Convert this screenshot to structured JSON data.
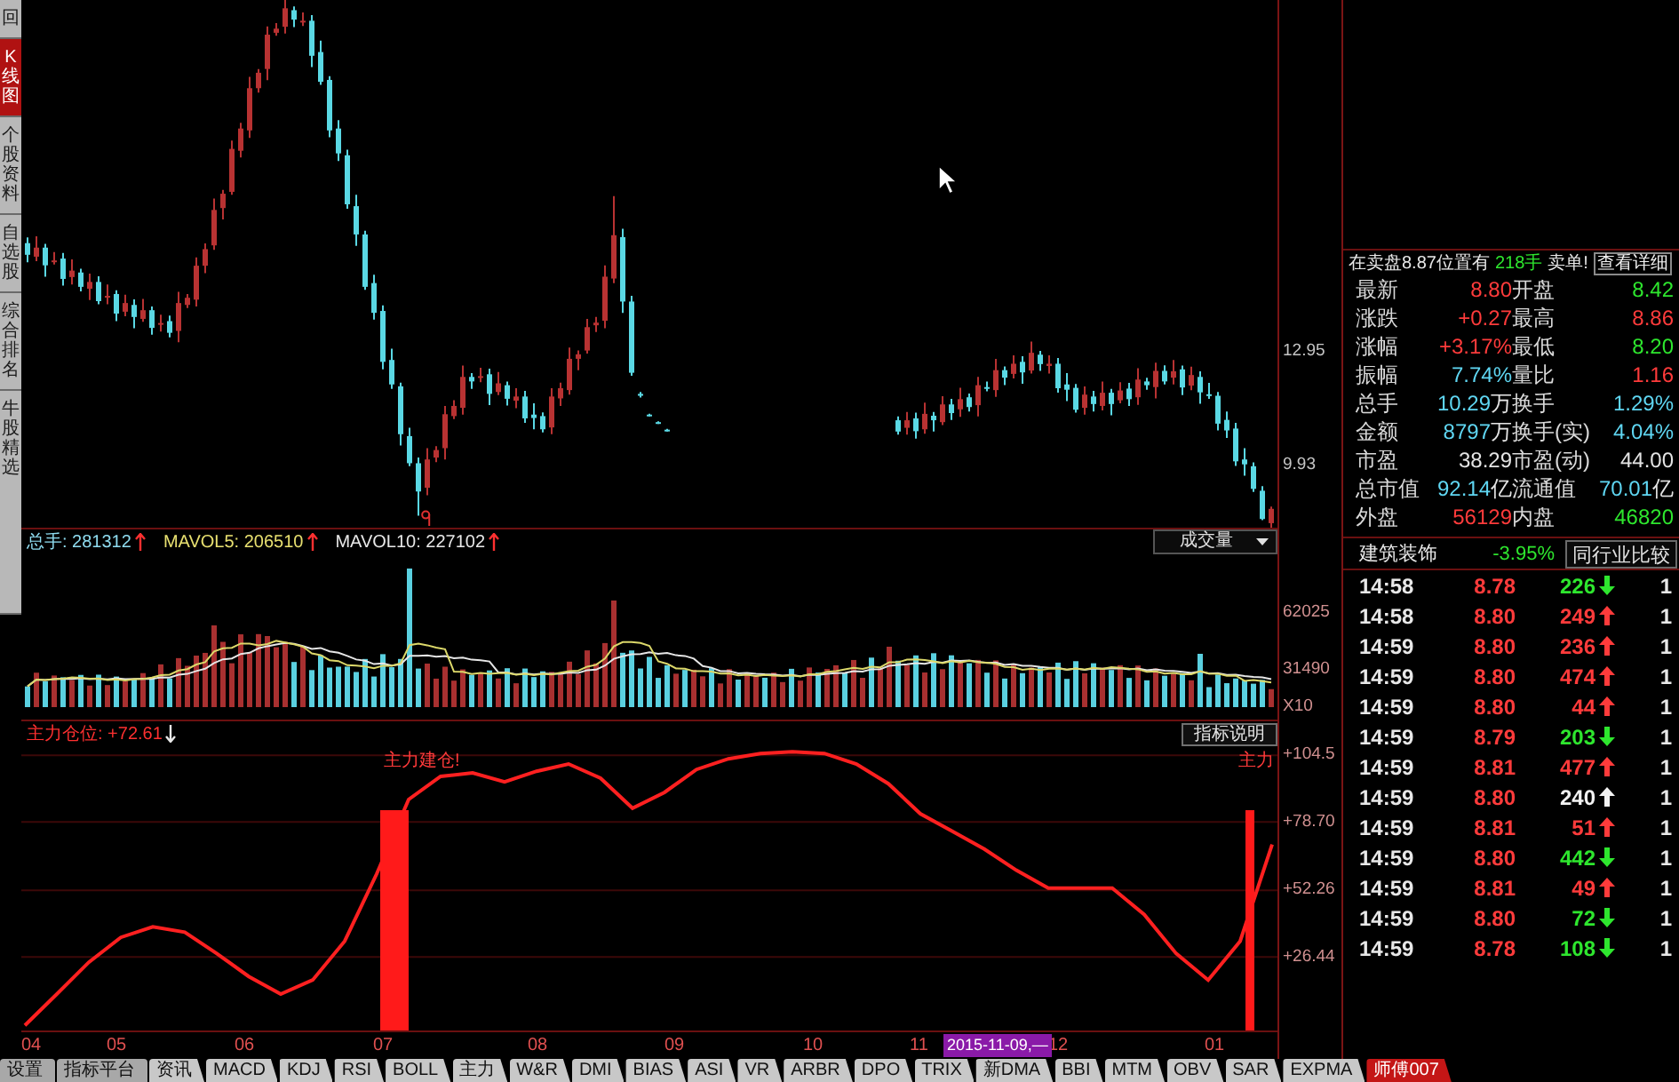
{
  "sidebar": {
    "tabs": [
      {
        "label": "回",
        "selected": false
      },
      {
        "label": "K线图",
        "selected": true
      },
      {
        "label": "个股资料",
        "selected": false
      },
      {
        "label": "自选股",
        "selected": false
      },
      {
        "label": "综合排名",
        "selected": false
      },
      {
        "label": "牛股精选",
        "selected": false
      }
    ]
  },
  "kline": {
    "chart_data": {
      "type": "candlestick",
      "ylim": [
        8.3,
        22.3
      ],
      "yticks": [
        {
          "value": 12.95,
          "label": "12.95"
        },
        {
          "value": 9.93,
          "label": "9.93"
        }
      ],
      "categories": [
        null,
        null,
        null,
        null,
        null,
        null,
        null,
        null,
        null,
        null,
        null,
        null,
        null,
        null,
        null,
        null,
        null,
        null,
        null,
        null,
        null,
        null,
        null,
        null,
        null,
        null,
        null,
        null,
        null,
        null,
        null,
        null,
        null,
        null,
        null,
        null,
        null,
        null,
        null,
        null,
        null,
        null,
        null,
        null,
        null,
        null,
        null,
        null,
        null,
        null,
        null,
        null,
        null,
        null,
        null,
        null,
        null,
        null,
        null,
        null,
        null,
        null,
        null,
        null,
        null,
        null,
        null,
        null,
        null,
        null,
        null,
        null,
        null,
        null,
        null,
        null,
        null,
        null,
        null,
        null,
        null,
        null,
        null,
        null,
        null,
        null,
        null,
        null,
        null,
        null,
        null,
        null,
        null,
        null,
        null,
        null,
        null,
        null,
        null,
        null,
        null,
        null,
        null,
        null,
        null,
        null,
        null,
        null,
        null,
        null,
        null,
        null,
        null,
        null,
        null,
        null,
        null,
        null,
        null,
        null,
        null,
        null,
        null,
        null,
        null,
        null,
        null,
        null,
        null,
        null,
        null,
        null,
        null,
        null,
        null,
        null,
        null,
        null,
        null,
        null,
        null
      ],
      "ohlc": [
        [
          15.85,
          16.0,
          15.34,
          15.54
        ],
        [
          15.49,
          16.03,
          15.37,
          15.73
        ],
        [
          15.73,
          15.83,
          14.96,
          15.26
        ],
        [
          15.36,
          15.61,
          15.28,
          15.39
        ],
        [
          15.44,
          15.59,
          14.72,
          14.9
        ],
        [
          14.95,
          15.42,
          14.75,
          15.12
        ],
        [
          15.07,
          15.17,
          14.57,
          14.69
        ],
        [
          14.64,
          15.04,
          14.34,
          14.82
        ],
        [
          14.82,
          14.97,
          14.23,
          14.31
        ],
        [
          14.41,
          14.75,
          14.23,
          14.45
        ],
        [
          14.5,
          14.6,
          13.78,
          13.98
        ],
        [
          14.03,
          14.48,
          13.91,
          14.26
        ],
        [
          14.21,
          14.36,
          13.59,
          13.89
        ],
        [
          13.84,
          14.37,
          13.76,
          14.07
        ],
        [
          14.07,
          14.17,
          13.42,
          13.6
        ],
        [
          13.7,
          13.95,
          13.5,
          13.73
        ],
        [
          13.78,
          13.93,
          13.35,
          13.47
        ],
        [
          13.52,
          14.56,
          13.22,
          14.26
        ],
        [
          14.21,
          14.5,
          14.13,
          14.4
        ],
        [
          14.35,
          15.47,
          14.17,
          15.25
        ],
        [
          15.25,
          15.84,
          15.05,
          15.69
        ],
        [
          15.79,
          17.03,
          15.67,
          16.73
        ],
        [
          16.78,
          17.26,
          16.48,
          17.16
        ],
        [
          17.21,
          18.57,
          17.13,
          18.35
        ],
        [
          18.3,
          19.04,
          18.12,
          18.89
        ],
        [
          18.84,
          20.26,
          18.64,
          19.96
        ],
        [
          19.96,
          20.47,
          19.84,
          20.37
        ],
        [
          20.47,
          21.6,
          20.17,
          21.38
        ],
        [
          21.43,
          21.69,
          21.35,
          21.54
        ],
        [
          21.59,
          22.38,
          21.41,
          22.08
        ],
        [
          22.03,
          22.13,
          21.58,
          21.78
        ],
        [
          21.73,
          21.97,
          21.61,
          21.75
        ],
        [
          21.75,
          21.9,
          20.52,
          20.82
        ],
        [
          20.92,
          21.22,
          20.05,
          20.13
        ],
        [
          20.18,
          20.28,
          18.66,
          18.84
        ],
        [
          18.89,
          19.11,
          18.03,
          18.23
        ],
        [
          18.18,
          18.33,
          16.76,
          16.88
        ],
        [
          16.83,
          17.13,
          15.78,
          16.08
        ],
        [
          16.08,
          16.18,
          14.61,
          14.69
        ],
        [
          14.79,
          15.01,
          13.82,
          14.0
        ],
        [
          14.05,
          14.2,
          12.5,
          12.7
        ],
        [
          12.75,
          13.05,
          11.98,
          12.1
        ],
        [
          12.05,
          12.15,
          10.48,
          10.78
        ],
        [
          10.73,
          10.95,
          9.93,
          10.01
        ],
        [
          10.01,
          10.16,
          8.62,
          9.26
        ],
        [
          9.36,
          10.41,
          9.16,
          10.11
        ],
        [
          10.16,
          10.46,
          10.04,
          10.36
        ],
        [
          10.41,
          11.53,
          10.11,
          11.31
        ],
        [
          11.26,
          11.68,
          11.18,
          11.53
        ],
        [
          11.48,
          12.6,
          11.3,
          12.3
        ],
        [
          12.3,
          12.4,
          11.98,
          12.18
        ],
        [
          12.28,
          12.54,
          12.16,
          12.32
        ],
        [
          12.37,
          12.52,
          11.55,
          11.85
        ],
        [
          11.9,
          12.43,
          11.82,
          12.13
        ],
        [
          12.08,
          12.18,
          11.54,
          11.72
        ],
        [
          11.67,
          12.0,
          11.47,
          11.78
        ],
        [
          11.78,
          11.93,
          11.08,
          11.2
        ],
        [
          11.3,
          11.6,
          10.91,
          11.21
        ],
        [
          11.26,
          11.36,
          10.83,
          10.91
        ],
        [
          10.96,
          12.0,
          10.78,
          11.78
        ],
        [
          11.73,
          12.15,
          11.53,
          12.0
        ],
        [
          11.95,
          13.08,
          11.83,
          12.78
        ],
        [
          12.78,
          13.0,
          12.48,
          12.9
        ],
        [
          13.0,
          13.84,
          12.92,
          13.62
        ],
        [
          13.67,
          13.89,
          13.49,
          13.74
        ],
        [
          13.79,
          15.26,
          13.59,
          14.96
        ],
        [
          14.91,
          17.1,
          14.79,
          16.06
        ],
        [
          16.01,
          16.23,
          14.0,
          14.3
        ],
        [
          14.3,
          14.45,
          12.33,
          12.41
        ],
        [
          11.85,
          11.9,
          11.75,
          11.8
        ],
        [
          11.3,
          11.32,
          11.25,
          11.27
        ],
        [
          11.1,
          11.12,
          11.05,
          11.07
        ],
        [
          10.9,
          10.92,
          10.85,
          10.87
        ],
        null,
        null,
        null,
        null,
        null,
        null,
        null,
        null,
        null,
        null,
        null,
        null,
        null,
        null,
        null,
        null,
        null,
        null,
        null,
        null,
        null,
        null,
        null,
        null,
        null,
        [
          11.15,
          11.25,
          10.77,
          10.85
        ],
        [
          10.95,
          11.37,
          10.77,
          11.15
        ],
        [
          11.2,
          11.35,
          10.66,
          10.86
        ],
        [
          10.91,
          11.62,
          10.79,
          11.32
        ],
        [
          11.27,
          11.37,
          10.85,
          11.15
        ],
        [
          11.1,
          11.79,
          11.02,
          11.57
        ],
        [
          11.57,
          11.72,
          11.16,
          11.34
        ],
        [
          11.44,
          12.01,
          11.24,
          11.71
        ],
        [
          11.76,
          11.86,
          11.38,
          11.5
        ],
        [
          11.55,
          12.3,
          11.25,
          12.08
        ],
        [
          12.03,
          12.18,
          11.92,
          12.0
        ],
        [
          11.95,
          12.78,
          11.77,
          12.48
        ],
        [
          12.48,
          12.58,
          12.08,
          12.28
        ],
        [
          12.38,
          12.87,
          12.26,
          12.65
        ],
        [
          12.7,
          12.85,
          12.12,
          12.42
        ],
        [
          12.47,
          13.24,
          12.39,
          12.94
        ],
        [
          12.89,
          12.99,
          12.46,
          12.64
        ],
        [
          12.59,
          12.87,
          12.39,
          12.65
        ],
        [
          12.65,
          12.8,
          11.88,
          12.0
        ],
        [
          12.1,
          12.4,
          11.66,
          11.96
        ],
        [
          12.01,
          12.11,
          11.35,
          11.43
        ],
        [
          11.48,
          12.05,
          11.3,
          11.83
        ],
        [
          11.78,
          11.93,
          11.38,
          11.58
        ],
        [
          11.53,
          12.18,
          11.41,
          11.88
        ],
        [
          11.88,
          11.98,
          11.28,
          11.58
        ],
        [
          11.68,
          12.16,
          11.6,
          11.94
        ],
        [
          11.99,
          12.14,
          11.53,
          11.71
        ],
        [
          11.76,
          12.53,
          11.56,
          12.23
        ],
        [
          12.18,
          12.28,
          11.96,
          12.08
        ],
        [
          12.03,
          12.68,
          11.73,
          12.46
        ],
        [
          12.46,
          12.61,
          12.1,
          12.18
        ],
        [
          12.28,
          12.75,
          12.1,
          12.45
        ],
        [
          12.5,
          12.6,
          11.82,
          12.02
        ],
        [
          12.07,
          12.57,
          11.95,
          12.35
        ],
        [
          12.3,
          12.45,
          11.59,
          11.89
        ],
        [
          11.84,
          12.14,
          11.72,
          11.8
        ],
        [
          11.8,
          11.9,
          10.88,
          11.06
        ],
        [
          11.16,
          11.38,
          10.68,
          10.88
        ],
        [
          10.93,
          11.08,
          9.94,
          10.06
        ],
        [
          10.11,
          10.41,
          9.68,
          9.98
        ],
        [
          9.93,
          10.03,
          9.25,
          9.33
        ],
        [
          9.28,
          9.4,
          8.5,
          8.53
        ],
        [
          8.42,
          8.86,
          8.2,
          8.8
        ]
      ]
    }
  },
  "volume": {
    "legend": [
      {
        "text": "总手: 281312",
        "color": "#8fdcf0",
        "rising": true
      },
      {
        "text": "MAVOL5: 206510",
        "color": "#e8e070",
        "rising": true
      },
      {
        "text": "MAVOL10: 227102",
        "color": "#e8e8e8",
        "rising": true
      }
    ],
    "selector": {
      "value": "成交量"
    },
    "ticks": [
      "62025",
      "31490",
      "X10"
    ]
  },
  "indicator": {
    "title": "主力仓位: +72.61",
    "rising": false,
    "help_button": "指标说明",
    "signals": [
      {
        "label": "主力建仓!"
      },
      {
        "label": "主力"
      }
    ],
    "chart_data": {
      "type": "line",
      "grid": true,
      "series": [
        {
          "color": "#ff2020",
          "values": [
            0.0,
            12.1,
            24.4,
            34.0,
            38.1,
            36.0,
            27.8,
            18.9,
            12.1,
            17.5,
            32.6,
            58.6,
            87.4,
            96.3,
            97.7,
            94.2,
            98.3,
            101.1,
            95.6,
            84.0,
            90.1,
            99.0,
            103.1,
            105.2,
            105.9,
            105.2,
            101.1,
            93.5,
            81.9,
            75.1,
            68.2,
            60.0,
            53.1,
            53.1,
            53.1,
            42.9,
            27.8,
            17.5,
            32.6,
            70.0
          ]
        }
      ],
      "ylim": [
        -2,
        108
      ],
      "yticks": [
        {
          "value": 104.5,
          "label": "+104.5"
        },
        {
          "value": 78.7,
          "label": "+78.70"
        },
        {
          "value": 52.26,
          "label": "+52.26"
        },
        {
          "value": 26.44,
          "label": "+26.44"
        }
      ]
    }
  },
  "x_axis": {
    "labels": [
      "04",
      "05",
      "06",
      "07",
      "08",
      "09",
      "10",
      "11",
      "12",
      "01"
    ],
    "cursor_date": "2015-11-09,—"
  },
  "quote_panel": {
    "notice": {
      "text": "在卖盘8.87位置有",
      "volume": "218手",
      "suffix": "卖单!",
      "link": "查看详细"
    },
    "fields": [
      {
        "label": "最新",
        "value": "8.80",
        "color": "#ff3b3b"
      },
      {
        "label": "开盘",
        "value": "8.42",
        "color": "#2ee62e"
      },
      {
        "label": "涨跌",
        "value": "+0.27",
        "color": "#ff3b3b"
      },
      {
        "label": "最高",
        "value": "8.86",
        "color": "#ff3b3b"
      },
      {
        "label": "涨幅",
        "value": "+3.17%",
        "color": "#ff3b3b"
      },
      {
        "label": "最低",
        "value": "8.20",
        "color": "#2ee62e"
      },
      {
        "label": "振幅",
        "value": "7.74%",
        "color": "#5fd6f2"
      },
      {
        "label": "量比",
        "value": "1.16",
        "color": "#ff3b3b"
      },
      {
        "label": "总手",
        "value": "10.29",
        "unit": "万",
        "color": "#5fd6f2"
      },
      {
        "label": "换手",
        "value": "1.29%",
        "color": "#5fd6f2"
      },
      {
        "label": "金额",
        "value": "8797",
        "unit": "万",
        "color": "#5fd6f2"
      },
      {
        "label": "换手(实)",
        "value": "4.04%",
        "color": "#5fd6f2"
      },
      {
        "label": "市盈",
        "value": "38.29",
        "color": "#e4e4e4"
      },
      {
        "label": "市盈(动)",
        "value": "44.00",
        "color": "#e4e4e4"
      },
      {
        "label": "总市值",
        "value": "92.14",
        "unit": "亿",
        "color": "#5fd6f2"
      },
      {
        "label": "流通值",
        "value": "70.01",
        "unit": "亿",
        "color": "#5fd6f2"
      },
      {
        "label": "外盘",
        "value": "56129",
        "color": "#ff3b3b"
      },
      {
        "label": "内盘",
        "value": "46820",
        "color": "#2ee62e"
      }
    ],
    "sector": {
      "name": "建筑装饰",
      "change": "-3.95%",
      "color": "#2ee62e",
      "button": "同行业比较"
    },
    "trades": [
      {
        "time": "14:58",
        "price": "8.78",
        "volume": "226",
        "color": "#2ee62e",
        "rising": false,
        "column_4": "1"
      },
      {
        "time": "14:58",
        "price": "8.80",
        "volume": "249",
        "color": "#ff3b3b",
        "rising": true,
        "column_4": "1"
      },
      {
        "time": "14:59",
        "price": "8.80",
        "volume": "236",
        "color": "#ff3b3b",
        "rising": true,
        "column_4": "1"
      },
      {
        "time": "14:59",
        "price": "8.80",
        "volume": "474",
        "color": "#ff3b3b",
        "rising": true,
        "column_4": "1"
      },
      {
        "time": "14:59",
        "price": "8.80",
        "volume": "44",
        "color": "#ff3b3b",
        "rising": true,
        "column_4": "1"
      },
      {
        "time": "14:59",
        "price": "8.79",
        "volume": "203",
        "color": "#2ee62e",
        "rising": false,
        "column_4": "1"
      },
      {
        "time": "14:59",
        "price": "8.81",
        "volume": "477",
        "color": "#ff3b3b",
        "rising": true,
        "column_4": "1"
      },
      {
        "time": "14:59",
        "price": "8.80",
        "volume": "240",
        "color": "#f2f2f2",
        "rising": true,
        "column_4": "1"
      },
      {
        "time": "14:59",
        "price": "8.81",
        "volume": "51",
        "color": "#ff3b3b",
        "rising": true,
        "column_4": "1"
      },
      {
        "time": "14:59",
        "price": "8.80",
        "volume": "442",
        "color": "#2ee62e",
        "rising": false,
        "column_4": "1"
      },
      {
        "time": "14:59",
        "price": "8.81",
        "volume": "49",
        "color": "#ff3b3b",
        "rising": true,
        "column_4": "1"
      },
      {
        "time": "14:59",
        "price": "8.80",
        "volume": "72",
        "color": "#2ee62e",
        "rising": false,
        "column_4": "1"
      },
      {
        "time": "14:59",
        "price": "8.78",
        "volume": "108",
        "color": "#2ee62e",
        "rising": false,
        "column_4": "1"
      }
    ]
  },
  "bottom_tabs": [
    {
      "label": "设置",
      "kind": "button",
      "selected": false
    },
    {
      "label": "指标平台",
      "kind": "button",
      "selected": false
    },
    {
      "label": "资讯",
      "kind": "tab",
      "selected": false
    },
    {
      "label": "MACD",
      "kind": "tab",
      "selected": false
    },
    {
      "label": "KDJ",
      "kind": "tab",
      "selected": false
    },
    {
      "label": "RSI",
      "kind": "tab",
      "selected": false
    },
    {
      "label": "BOLL",
      "kind": "tab",
      "selected": false
    },
    {
      "label": "主力",
      "kind": "tab",
      "selected": false
    },
    {
      "label": "W&R",
      "kind": "tab",
      "selected": false
    },
    {
      "label": "DMI",
      "kind": "tab",
      "selected": false
    },
    {
      "label": "BIAS",
      "kind": "tab",
      "selected": false
    },
    {
      "label": "ASI",
      "kind": "tab",
      "selected": false
    },
    {
      "label": "VR",
      "kind": "tab",
      "selected": false
    },
    {
      "label": "ARBR",
      "kind": "tab",
      "selected": false
    },
    {
      "label": "DPO",
      "kind": "tab",
      "selected": false
    },
    {
      "label": "TRIX",
      "kind": "tab",
      "selected": false
    },
    {
      "label": "新DMA",
      "kind": "tab",
      "selected": false
    },
    {
      "label": "BBI",
      "kind": "tab",
      "selected": false
    },
    {
      "label": "MTM",
      "kind": "tab",
      "selected": false
    },
    {
      "label": "OBV",
      "kind": "tab",
      "selected": false
    },
    {
      "label": "SAR",
      "kind": "tab",
      "selected": false
    },
    {
      "label": "EXPMA",
      "kind": "tab",
      "selected": false
    },
    {
      "label": "师傅007",
      "kind": "tab",
      "selected": true
    }
  ]
}
